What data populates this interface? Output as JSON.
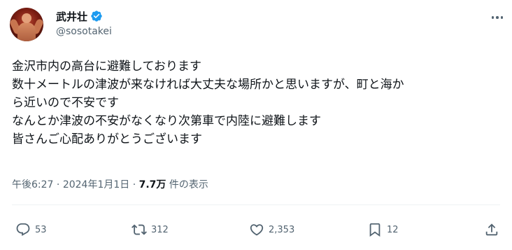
{
  "author": {
    "display_name": "武井壮",
    "handle": "@sosotakei"
  },
  "tweet": {
    "lines": [
      "金沢市内の高台に避難しております",
      "数十メートルの津波が来なければ大丈夫な場所かと思いますが、町と海か",
      "ら近いので不安です",
      "なんとか津波の不安がなくなり次第車で内陸に避難します",
      "皆さんご心配ありがとうございます"
    ]
  },
  "meta": {
    "time": "午後6:27",
    "separator": "·",
    "date": "2024年1月1日",
    "views_count": "7.7万",
    "views_label": "件の表示"
  },
  "actions": {
    "replies": "53",
    "reposts": "312",
    "likes": "2,353",
    "bookmarks": "12"
  },
  "icons": [
    "verified-badge-icon",
    "more-icon",
    "reply-icon",
    "repost-icon",
    "like-icon",
    "bookmark-icon",
    "share-icon"
  ],
  "colors": {
    "verified": "#1d9bf0",
    "secondary_text": "#536471",
    "primary_text": "#0f1419"
  }
}
